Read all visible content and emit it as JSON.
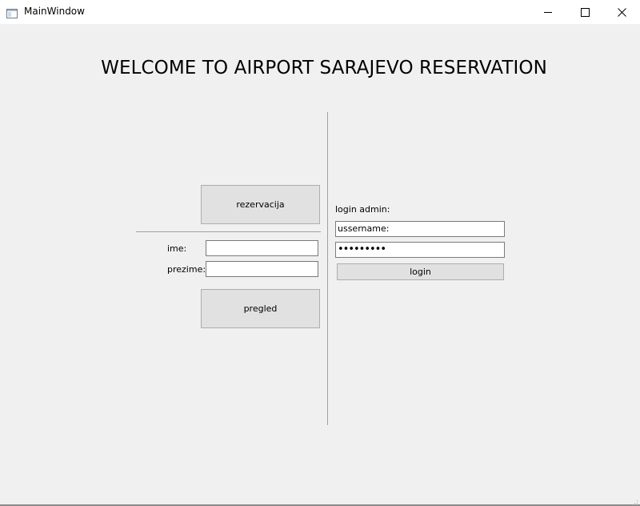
{
  "window": {
    "title": "MainWindow",
    "icon": "window-app-icon",
    "controls": [
      "minimize-icon",
      "maximize-icon",
      "close-icon"
    ]
  },
  "main": {
    "welcome": "WELCOME TO AIRPORT SARAJEVO RESERVATION",
    "reservation_button": "rezervacija",
    "ime_label": "ime:",
    "ime_value": "",
    "prezime_label": "prezime:",
    "prezime_value": "",
    "pregled_button": "pregled"
  },
  "admin": {
    "label": "login admin:",
    "username_value": "ussername:",
    "password_value": "•••••••••",
    "login_button": "login"
  },
  "colors": {
    "client_bg": "#f0f0f0",
    "button_bg": "#e1e1e1",
    "button_border": "#adadad",
    "input_border": "#7a7a7a",
    "separator": "#a0a0a0"
  }
}
